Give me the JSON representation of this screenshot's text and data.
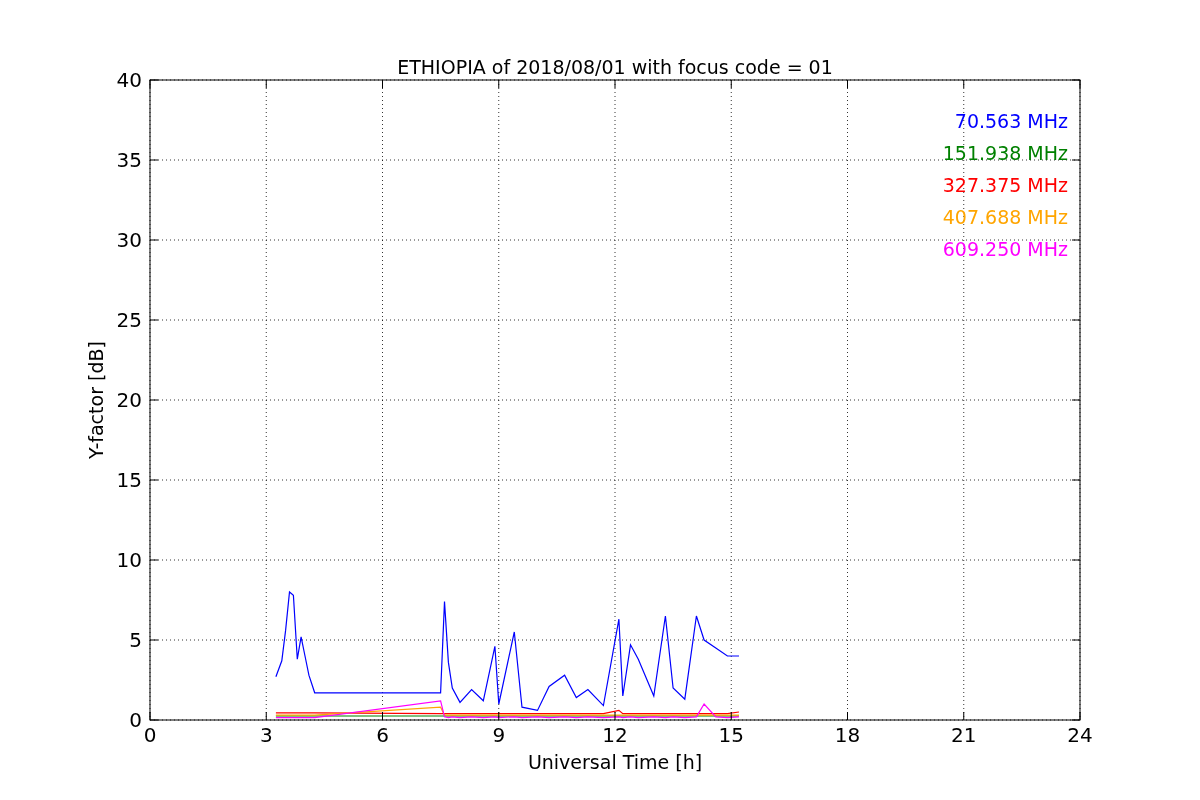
{
  "chart_data": {
    "type": "line",
    "title": "ETHIOPIA of 2018/08/01 with focus code = 01",
    "xlabel": "Universal Time [h]",
    "ylabel": "Y-factor [dB]",
    "xlim": [
      0,
      24
    ],
    "ylim": [
      0,
      40
    ],
    "xticks": [
      0,
      3,
      6,
      9,
      12,
      15,
      18,
      21,
      24
    ],
    "yticks": [
      0,
      5,
      10,
      15,
      20,
      25,
      30,
      35,
      40
    ],
    "grid": true,
    "x": [
      3.25,
      3.4,
      3.5,
      3.6,
      3.7,
      3.8,
      3.9,
      4.0,
      4.1,
      4.25,
      7.5,
      7.6,
      7.7,
      7.8,
      8.0,
      8.3,
      8.6,
      8.9,
      9.0,
      9.4,
      9.6,
      10.0,
      10.3,
      10.7,
      11.0,
      11.3,
      11.7,
      12.1,
      12.2,
      12.4,
      12.6,
      13.0,
      13.3,
      13.5,
      13.8,
      14.1,
      14.3,
      14.6,
      14.9,
      15.2
    ],
    "series": [
      {
        "name": "70.563 MHz",
        "color": "#0000ff",
        "values": [
          2.7,
          3.7,
          5.6,
          8.0,
          7.8,
          3.8,
          5.2,
          4.0,
          2.8,
          1.7,
          1.7,
          7.4,
          3.6,
          2.0,
          1.1,
          1.9,
          1.2,
          4.6,
          1.0,
          5.5,
          0.8,
          0.6,
          2.1,
          2.8,
          1.4,
          1.9,
          0.9,
          6.3,
          1.5,
          4.7,
          3.8,
          1.5,
          6.5,
          2.0,
          1.3,
          6.5,
          5.0,
          4.5,
          4.0,
          4.0
        ]
      },
      {
        "name": "151.938 MHz",
        "color": "#008000",
        "values": [
          0.25,
          0.25,
          0.25,
          0.25,
          0.25,
          0.25,
          0.25,
          0.25,
          0.25,
          0.25,
          0.25,
          0.25,
          0.25,
          0.25,
          0.25,
          0.25,
          0.25,
          0.25,
          0.25,
          0.25,
          0.25,
          0.25,
          0.25,
          0.25,
          0.25,
          0.25,
          0.25,
          0.25,
          0.25,
          0.25,
          0.25,
          0.25,
          0.25,
          0.25,
          0.25,
          0.25,
          0.25,
          0.25,
          0.25,
          0.25
        ]
      },
      {
        "name": "327.375 MHz",
        "color": "#ff0000",
        "values": [
          0.45,
          0.45,
          0.45,
          0.45,
          0.45,
          0.45,
          0.45,
          0.45,
          0.45,
          0.45,
          0.4,
          0.4,
          0.4,
          0.4,
          0.4,
          0.4,
          0.4,
          0.4,
          0.4,
          0.4,
          0.4,
          0.4,
          0.4,
          0.4,
          0.4,
          0.4,
          0.4,
          0.6,
          0.4,
          0.4,
          0.4,
          0.4,
          0.4,
          0.4,
          0.4,
          0.4,
          0.4,
          0.4,
          0.4,
          0.5
        ]
      },
      {
        "name": "407.688 MHz",
        "color": "#ffa500",
        "values": [
          0.3,
          0.3,
          0.3,
          0.3,
          0.3,
          0.3,
          0.3,
          0.3,
          0.3,
          0.3,
          0.8,
          0.3,
          0.3,
          0.3,
          0.3,
          0.3,
          0.3,
          0.3,
          0.3,
          0.3,
          0.3,
          0.3,
          0.3,
          0.3,
          0.3,
          0.3,
          0.3,
          0.3,
          0.3,
          0.3,
          0.3,
          0.3,
          0.3,
          0.3,
          0.3,
          0.3,
          0.3,
          0.3,
          0.3,
          0.3
        ]
      },
      {
        "name": "609.250 MHz",
        "color": "#ff00ff",
        "values": [
          0.15,
          0.15,
          0.15,
          0.15,
          0.15,
          0.15,
          0.15,
          0.15,
          0.15,
          0.15,
          1.2,
          0.2,
          0.15,
          0.2,
          0.15,
          0.2,
          0.15,
          0.2,
          0.15,
          0.2,
          0.15,
          0.2,
          0.15,
          0.2,
          0.15,
          0.2,
          0.15,
          0.2,
          0.15,
          0.2,
          0.15,
          0.2,
          0.15,
          0.2,
          0.15,
          0.2,
          1.0,
          0.2,
          0.15,
          0.2
        ]
      }
    ]
  }
}
